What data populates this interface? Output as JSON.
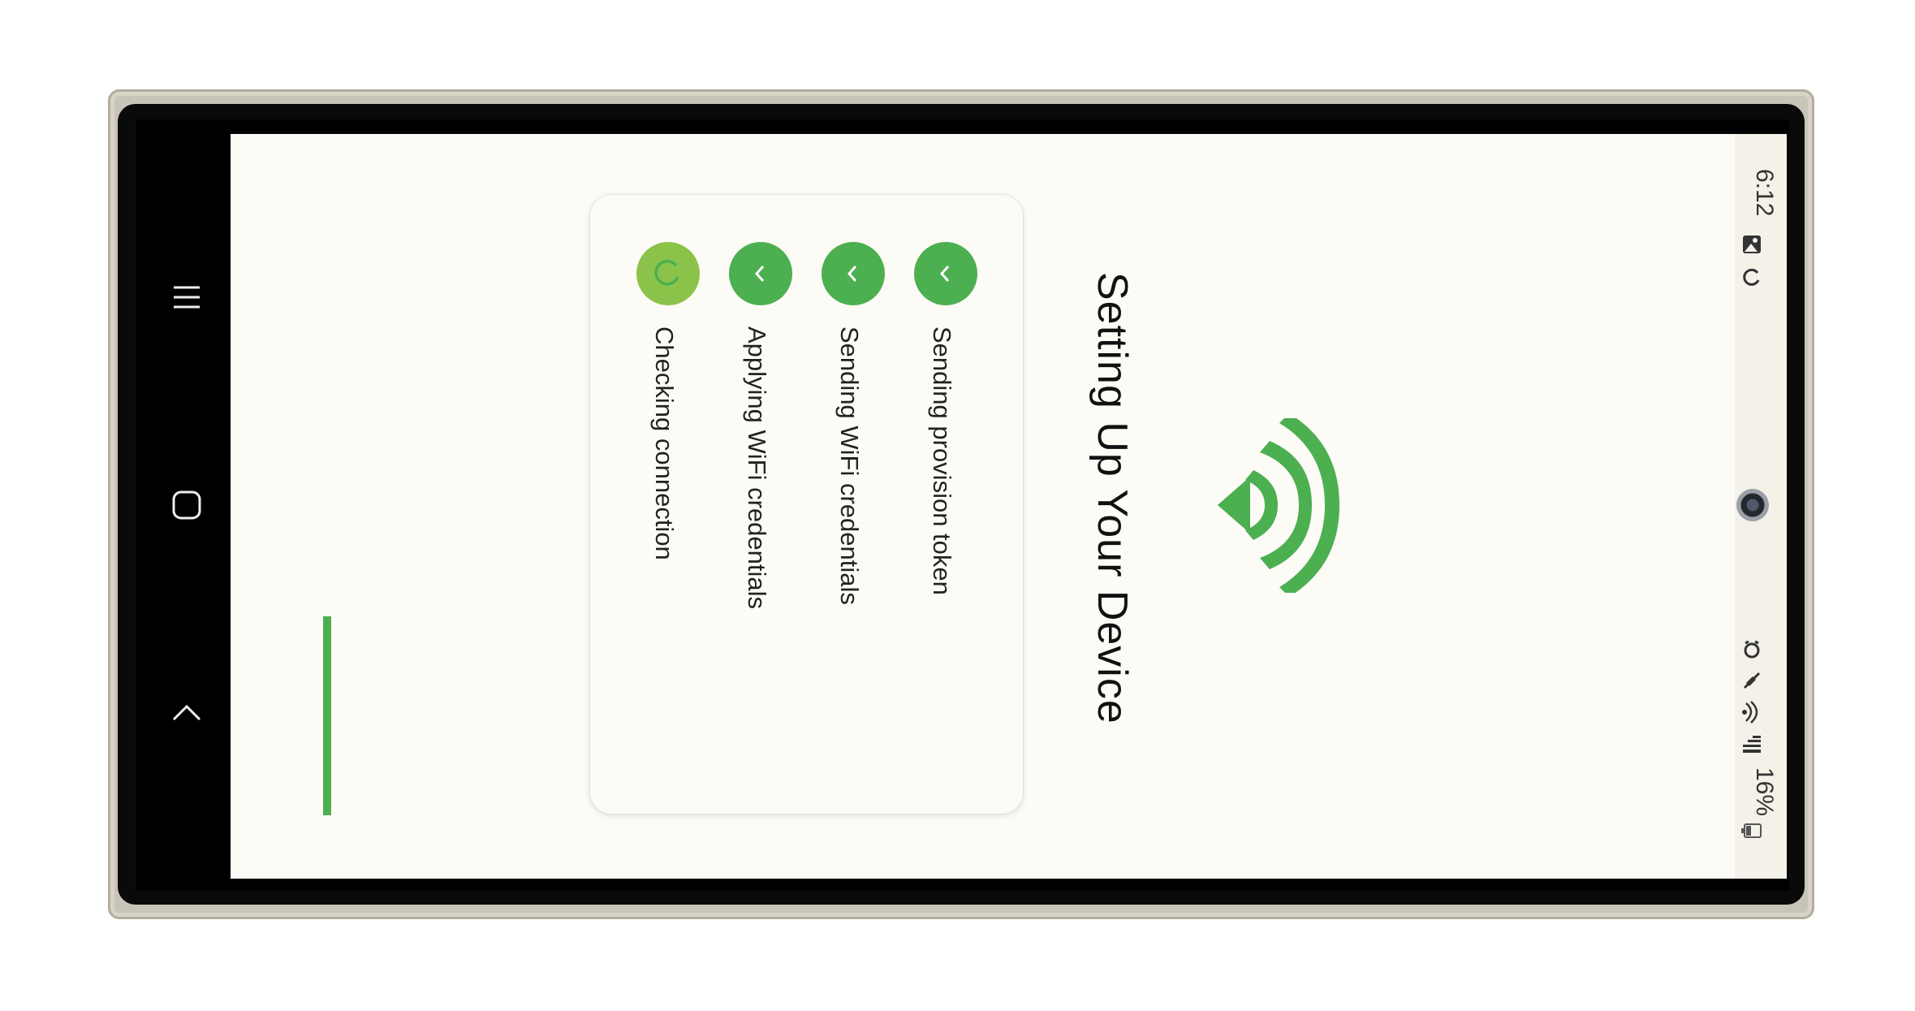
{
  "status_bar": {
    "time": "6:12",
    "battery": "16%",
    "icons_left": [
      "gallery-icon",
      "sync-icon"
    ],
    "icons_right": [
      "alarm-icon",
      "mute-icon",
      "wifi-calling-icon",
      "signal-icon",
      "battery-icon"
    ]
  },
  "nav_bar": {
    "buttons": [
      "recent-apps",
      "home",
      "back"
    ]
  },
  "page": {
    "title": "Setting Up Your Device",
    "icon": "wifi-icon",
    "accent_color": "#4caf50",
    "active_color": "#8bc34a"
  },
  "steps": [
    {
      "label": "Sending provision token",
      "status": "done"
    },
    {
      "label": "Sending WiFi credentials",
      "status": "done"
    },
    {
      "label": "Applying WiFi credentials",
      "status": "done"
    },
    {
      "label": "Checking connection",
      "status": "in-progress"
    }
  ]
}
